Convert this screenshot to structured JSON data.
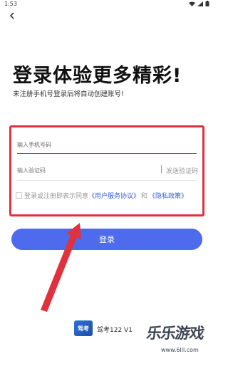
{
  "status_bar": {
    "time": "1:53"
  },
  "login": {
    "title": "登录体验更多精彩!",
    "subtitle": "未注册手机号登录后将自动创建账号!",
    "phone_placeholder": "输入手机号码",
    "code_placeholder": "输入验证码",
    "send_code_label": "发送验证码",
    "agreement_prefix": "登录或注册即表示同意",
    "terms_link": "《用户服务协议》",
    "and_text": "和",
    "privacy_link": "《隐私政策》",
    "login_button": "登录"
  },
  "footer": {
    "app_logo_text": "驾考",
    "app_name": "驾考122 V1"
  },
  "watermark": {
    "text": "乐乐游戏",
    "url": "www.6lll.com"
  },
  "colors": {
    "accent": "#4f6bed",
    "annotation_red": "#e0323e"
  },
  "icons": {
    "back": "back-arrow-icon",
    "wifi": "wifi-icon",
    "signal": "signal-icon",
    "battery": "battery-icon"
  }
}
